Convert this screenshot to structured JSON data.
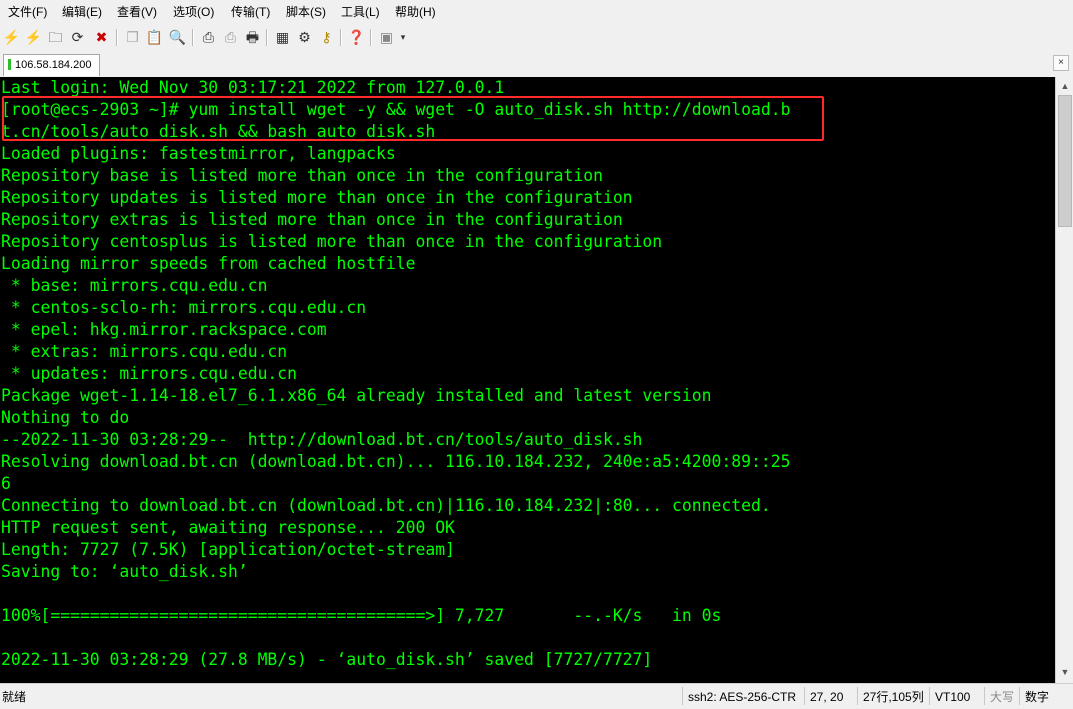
{
  "menu": [
    "文件(F)",
    "编辑(E)",
    "查看(V)",
    "选项(O)",
    "传输(T)",
    "脚本(S)",
    "工具(L)",
    "帮助(H)"
  ],
  "toolbar": {
    "icons": [
      "connect-icon",
      "quick-connect-icon",
      "connect-tab-icon",
      "reconnect-icon",
      "disconnect-icon",
      "copy-icon",
      "paste-icon",
      "find-icon",
      "print-icon",
      "print-setup-icon",
      "printer-icon",
      "settings-icon",
      "options-icon",
      "key-icon",
      "help-icon",
      "screen-icon",
      "dropdown-icon"
    ]
  },
  "tab": {
    "label": "106.58.184.200",
    "close": "×"
  },
  "terminal": {
    "lines": [
      "Last login: Wed Nov 30 03:17:21 2022 from 127.0.0.1",
      "[root@ecs-2903 ~]# yum install wget -y && wget -O auto_disk.sh http://download.b",
      "t.cn/tools/auto_disk.sh && bash auto_disk.sh",
      "Loaded plugins: fastestmirror, langpacks",
      "Repository base is listed more than once in the configuration",
      "Repository updates is listed more than once in the configuration",
      "Repository extras is listed more than once in the configuration",
      "Repository centosplus is listed more than once in the configuration",
      "Loading mirror speeds from cached hostfile",
      " * base: mirrors.cqu.edu.cn",
      " * centos-sclo-rh: mirrors.cqu.edu.cn",
      " * epel: hkg.mirror.rackspace.com",
      " * extras: mirrors.cqu.edu.cn",
      " * updates: mirrors.cqu.edu.cn",
      "Package wget-1.14-18.el7_6.1.x86_64 already installed and latest version",
      "Nothing to do",
      "--2022-11-30 03:28:29--  http://download.bt.cn/tools/auto_disk.sh",
      "Resolving download.bt.cn (download.bt.cn)... 116.10.184.232, 240e:a5:4200:89::25",
      "6",
      "Connecting to download.bt.cn (download.bt.cn)|116.10.184.232|:80... connected.",
      "HTTP request sent, awaiting response... 200 OK",
      "Length: 7727 (7.5K) [application/octet-stream]",
      "Saving to: ‘auto_disk.sh’",
      "",
      "100%[======================================>] 7,727       --.-K/s   in 0s",
      "",
      "2022-11-30 03:28:29 (27.8 MB/s) - ‘auto_disk.sh’ saved [7727/7727]"
    ]
  },
  "statusbar": {
    "ready": "就绪",
    "cipher": "ssh2: AES-256-CTR",
    "cursor": "27,  20",
    "size": "27行,105列",
    "term": "VT100",
    "caps": "大写",
    "num": "数字"
  },
  "colors": {
    "terminal_bg": "#000000",
    "terminal_fg": "#00ff00",
    "highlight_box": "#ff2a2a"
  }
}
